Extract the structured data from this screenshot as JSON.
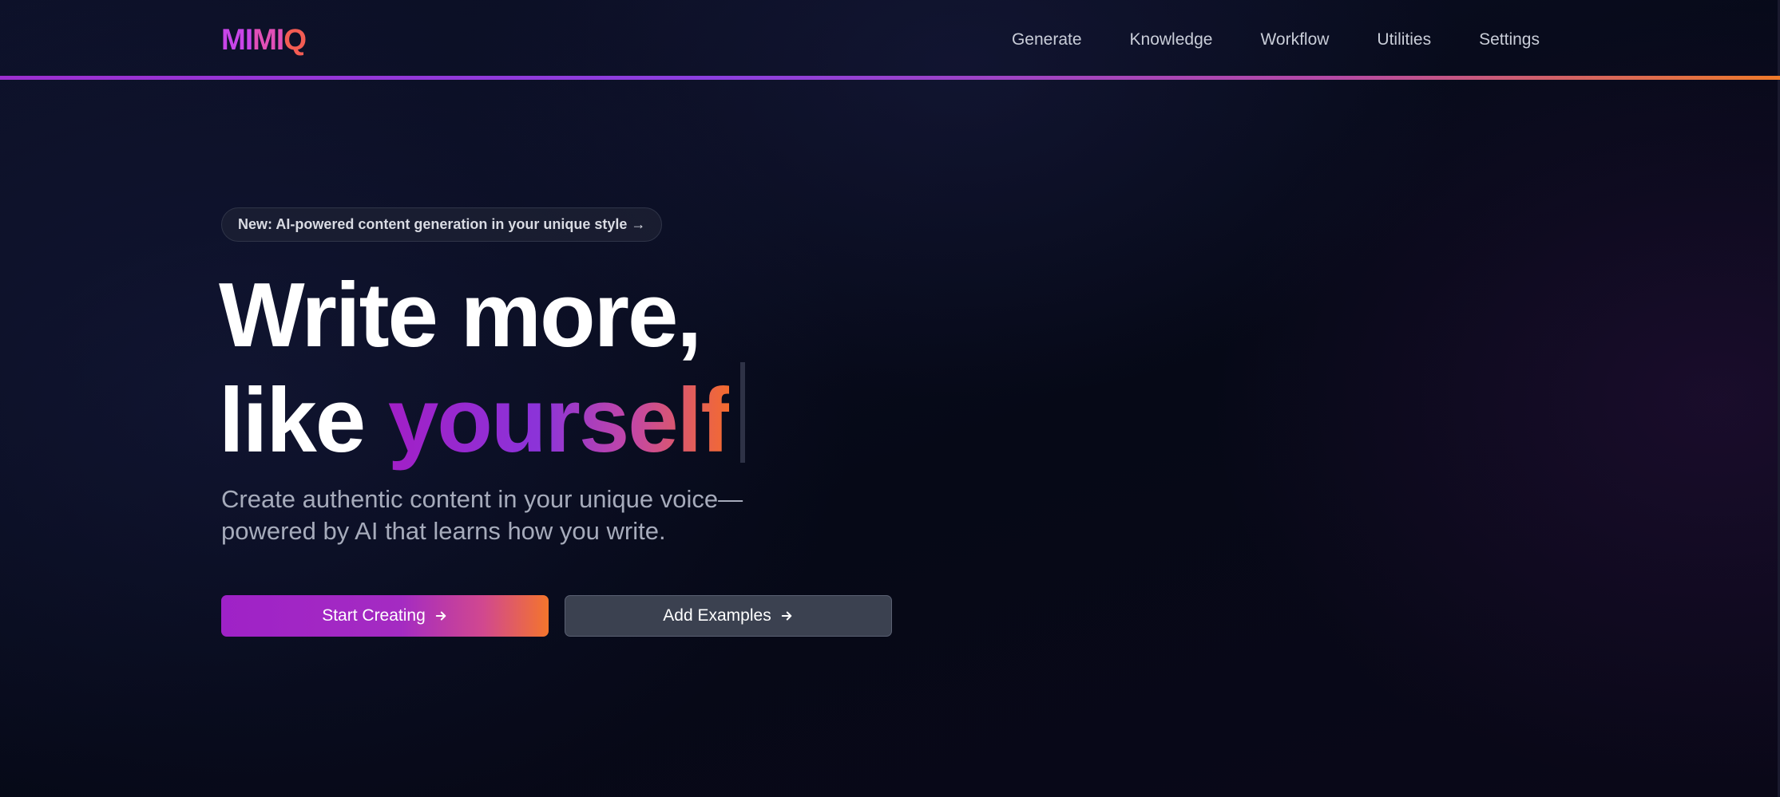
{
  "nav": {
    "logo_parts": [
      "MI",
      "MI",
      "Q"
    ],
    "links": [
      {
        "label": "Generate"
      },
      {
        "label": "Knowledge"
      },
      {
        "label": "Workflow"
      },
      {
        "label": "Utilities"
      },
      {
        "label": "Settings"
      }
    ]
  },
  "hero": {
    "badge": "New: AI-powered content generation in your unique style →",
    "headline_line1": "Write more,",
    "headline_line2_prefix": "like ",
    "headline_accent": "yourself",
    "subtitle_line1": "Create authentic content in your unique voice—",
    "subtitle_line2": "powered by AI that learns how you write.",
    "primary_button": "Start Creating",
    "secondary_button": "Add Examples"
  },
  "colors": {
    "background": "#080b1c",
    "accent_purple": "#9f22c7",
    "accent_orange": "#f4752c",
    "secondary_button": "#3b4150"
  },
  "icons": {
    "button_arrow": "arrow-right-icon"
  }
}
